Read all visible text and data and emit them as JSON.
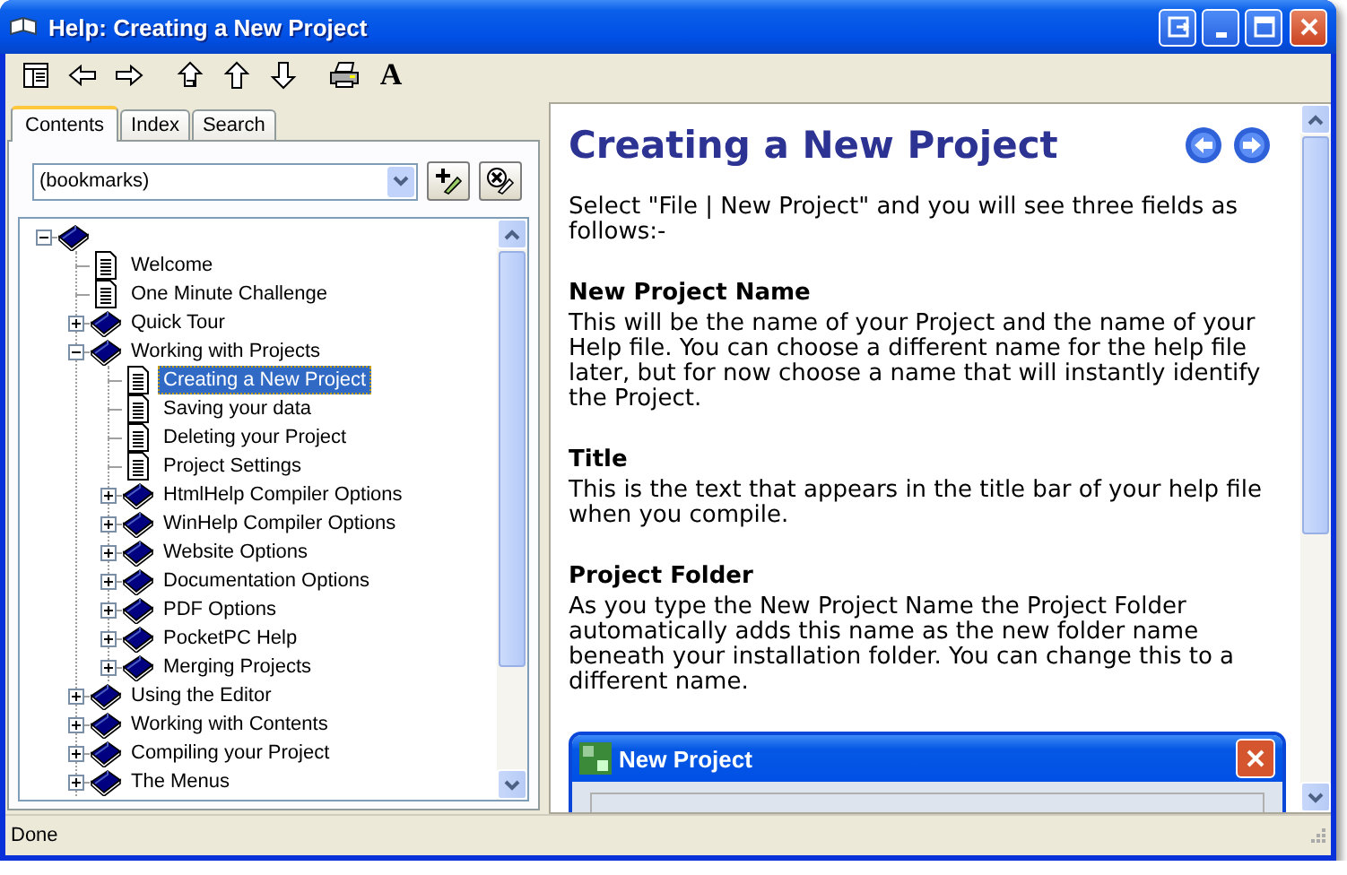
{
  "window": {
    "title": "Help: Creating a New Project"
  },
  "toolbar": {
    "font_glyph": "A"
  },
  "tabs": [
    {
      "label": "Contents",
      "selected": true
    },
    {
      "label": "Index",
      "selected": false
    },
    {
      "label": "Search",
      "selected": false
    }
  ],
  "bookmarks": {
    "value": "(bookmarks)"
  },
  "tree": [
    {
      "kind": "book",
      "expanded": true,
      "selected": false,
      "children": [
        {
          "label": "Welcome",
          "kind": "page",
          "selected": false
        },
        {
          "label": "One Minute Challenge",
          "kind": "page",
          "selected": false
        },
        {
          "label": "Quick Tour",
          "kind": "book",
          "expanded": false,
          "selected": false
        },
        {
          "label": "Working with Projects",
          "kind": "book",
          "expanded": true,
          "selected": false,
          "children": [
            {
              "label": "Creating a New Project",
              "kind": "page",
              "selected": true
            },
            {
              "label": "Saving your data",
              "kind": "page",
              "selected": false
            },
            {
              "label": "Deleting your Project",
              "kind": "page",
              "selected": false
            },
            {
              "label": "Project Settings",
              "kind": "page",
              "selected": false
            },
            {
              "label": "HtmlHelp Compiler Options",
              "kind": "book",
              "expanded": false,
              "selected": false
            },
            {
              "label": "WinHelp Compiler Options",
              "kind": "book",
              "expanded": false,
              "selected": false
            },
            {
              "label": "Website Options",
              "kind": "book",
              "expanded": false,
              "selected": false
            },
            {
              "label": "Documentation Options",
              "kind": "book",
              "expanded": false,
              "selected": false
            },
            {
              "label": "PDF Options",
              "kind": "book",
              "expanded": false,
              "selected": false
            },
            {
              "label": "PocketPC Help",
              "kind": "book",
              "expanded": false,
              "selected": false
            },
            {
              "label": "Merging Projects",
              "kind": "book",
              "expanded": false,
              "selected": false
            }
          ]
        },
        {
          "label": "Using the Editor",
          "kind": "book",
          "expanded": false,
          "selected": false
        },
        {
          "label": "Working with Contents",
          "kind": "book",
          "expanded": false,
          "selected": false
        },
        {
          "label": "Compiling your Project",
          "kind": "book",
          "expanded": false,
          "selected": false
        },
        {
          "label": "The Menus",
          "kind": "book",
          "expanded": false,
          "selected": false
        }
      ]
    }
  ],
  "content": {
    "heading": "Creating a New Project",
    "intro": "Select \"File | New Project\" and you will see three fields as follows:-",
    "sections": [
      {
        "heading": "New Project Name",
        "body": "This will be the name of your Project and the name of your Help file. You can choose a different name for the help file later, but for now choose a name that will instantly identify the Project."
      },
      {
        "heading": "Title",
        "body": "This is the text that appears in the title bar of your help file when you compile."
      },
      {
        "heading": "Project Folder",
        "body": "As you type the New Project Name the Project Folder automatically adds this name as the new folder name beneath your installation folder. You can change this to a different name."
      }
    ],
    "dialog": {
      "title": "New Project"
    }
  },
  "status_bar": {
    "text": "Done"
  }
}
